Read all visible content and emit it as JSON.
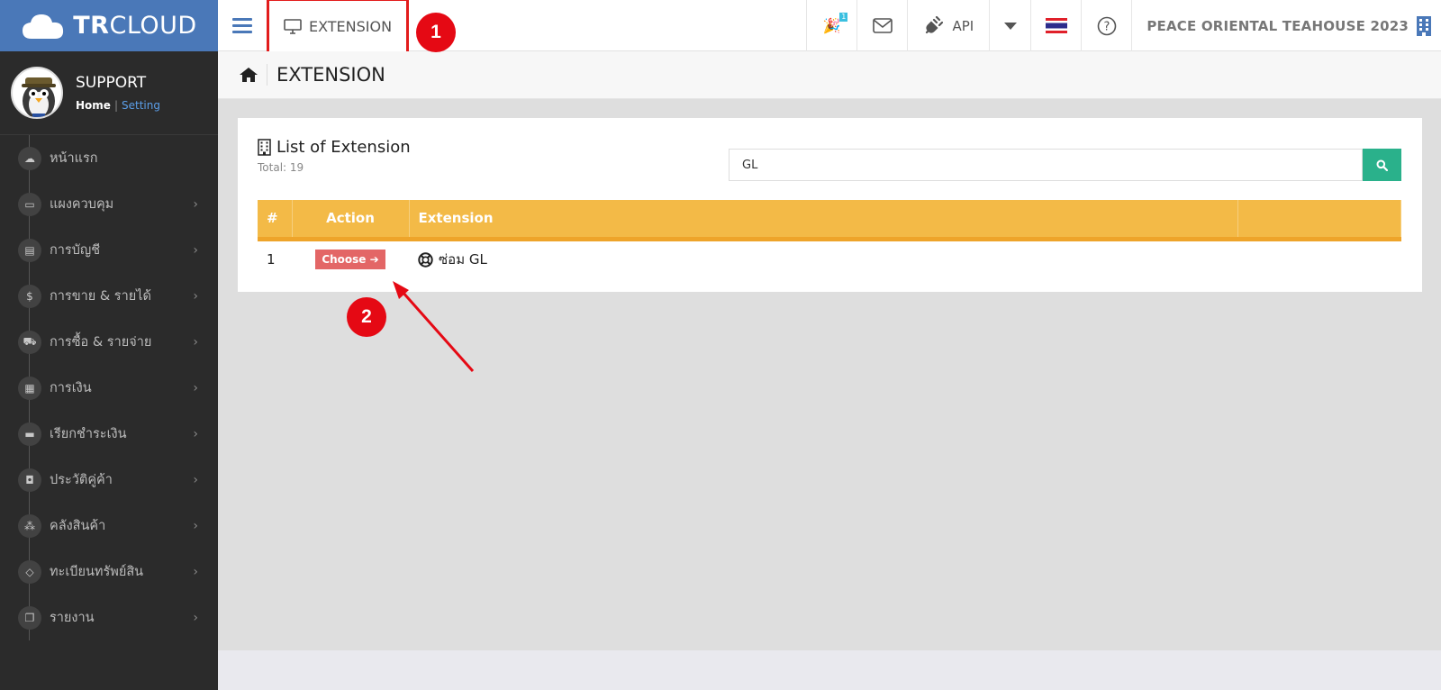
{
  "brand": {
    "bold": "TR",
    "light": "CLOUD"
  },
  "profile": {
    "name": "SUPPORT",
    "home_link": "Home",
    "separator": "|",
    "setting_link": "Setting"
  },
  "sidebar": {
    "items": [
      {
        "label": "หน้าแรก",
        "icon": "cloud-icon",
        "glyph": "☁",
        "has_arrow": false
      },
      {
        "label": "แผงควบคุม",
        "icon": "monitor-icon",
        "glyph": "▭",
        "has_arrow": true
      },
      {
        "label": "การบัญชี",
        "icon": "book-icon",
        "glyph": "▤",
        "has_arrow": true
      },
      {
        "label": "การขาย & รายได้",
        "icon": "dollar-icon",
        "glyph": "$",
        "has_arrow": true
      },
      {
        "label": "การซื้อ & รายจ่าย",
        "icon": "cart-icon",
        "glyph": "⛟",
        "has_arrow": true
      },
      {
        "label": "การเงิน",
        "icon": "calendar-icon",
        "glyph": "▦",
        "has_arrow": true
      },
      {
        "label": "เรียกชำระเงิน",
        "icon": "credit-card-icon",
        "glyph": "▬",
        "has_arrow": true
      },
      {
        "label": "ประวัติคู่ค้า",
        "icon": "contact-book-icon",
        "glyph": "◘",
        "has_arrow": true
      },
      {
        "label": "คลังสินค้า",
        "icon": "cubes-icon",
        "glyph": "⁂",
        "has_arrow": true
      },
      {
        "label": "ทะเบียนทรัพย์สิน",
        "icon": "diamond-icon",
        "glyph": "◇",
        "has_arrow": true
      },
      {
        "label": "รายงาน",
        "icon": "copy-icon",
        "glyph": "❐",
        "has_arrow": true
      }
    ],
    "arrow_glyph": "›"
  },
  "topbar": {
    "active_tab_label": "EXTENSION",
    "notification_count": "1",
    "api_label": "API",
    "company_name": "PEACE ORIENTAL TEAHOUSE 2023"
  },
  "page": {
    "title": "EXTENSION"
  },
  "panel": {
    "title": "List of Extension",
    "total_label": "Total: 19",
    "search_value": "GL",
    "table": {
      "headers": [
        "#",
        "Action",
        "Extension"
      ],
      "rows": [
        {
          "index": "1",
          "action_label": "Choose ➔",
          "extension_name": "ซ่อม GL"
        }
      ]
    }
  },
  "annotations": {
    "step1": "1",
    "step2": "2"
  },
  "colors": {
    "accent_blue": "#4a78b8",
    "sidebar_bg": "#2b2b2b",
    "table_header": "#f3ba47",
    "search_button": "#2ab18b",
    "choose_button": "#e36666",
    "annotation_red": "#e50914"
  }
}
